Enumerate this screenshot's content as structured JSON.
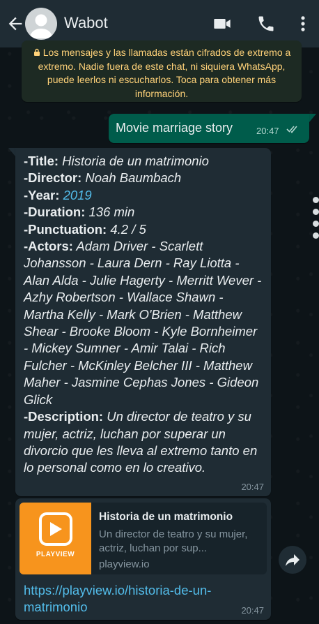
{
  "header": {
    "contact_name": "Wabot"
  },
  "notice": {
    "text": "Los mensajes y las llamadas están cifrados de extremo a extremo. Nadie fuera de este chat, ni siquiera WhatsApp, puede leerlos ni escucharlos. Toca para obtener más información."
  },
  "outgoing": {
    "text": "Movie marriage story",
    "time": "20:47"
  },
  "incoming": {
    "title_label": "-Title:",
    "title_value": "Historia de un matrimonio",
    "director_label": "-Director:",
    "director_value": "Noah Baumbach",
    "year_label": "-Year:",
    "year_value": "2019",
    "duration_label": "-Duration:",
    "duration_value": "136 min",
    "punctuation_label": "-Punctuation:",
    "punctuation_value": "4.2 / 5",
    "actors_label": "-Actors:",
    "actors_value": "Adam Driver - Scarlett Johansson - Laura Dern - Ray Liotta - Alan Alda - Julie Hagerty - Merritt Wever - Azhy Robertson - Wallace Shawn - Martha Kelly - Mark O'Brien - Matthew Shear - Brooke Bloom - Kyle Bornheimer - Mickey Sumner - Amir Talai - Rich Fulcher - McKinley Belcher III - Matthew Maher - Jasmine Cephas Jones - Gideon Glick",
    "description_label": "-Description:",
    "description_value": "Un director de teatro y su mujer, actriz, luchan por superar un divorcio que les lleva al extremo tanto en lo personal como en lo creativo.",
    "time": "20:47"
  },
  "link_preview": {
    "logo_text": "PLAYVIEW",
    "title": "Historia de un matrimonio",
    "description": "Un director de teatro y su mujer, actriz, luchan por sup...",
    "domain": "playview.io",
    "url": "https://playview.io/historia-de-un-matrimonio",
    "time": "20:47"
  },
  "colors": {
    "header_bg": "#1f2c34",
    "outgoing_bubble": "#005c4b",
    "incoming_bubble": "#1f2c34",
    "notice_text": "#ffd279",
    "link": "#53bdeb",
    "logo_bg": "#f7941d"
  },
  "icons": [
    "back-arrow-icon",
    "avatar-icon",
    "video-call-icon",
    "phone-icon",
    "more-vertical-icon",
    "lock-icon",
    "double-check-icon",
    "share-icon"
  ]
}
